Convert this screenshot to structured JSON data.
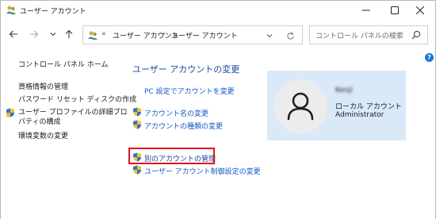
{
  "window": {
    "title": "ユーザー アカウント"
  },
  "address": {
    "separator": "«",
    "crumbs": [
      "ユーザー アカウント",
      "ユーザー アカウント"
    ],
    "crumb_separator": "›"
  },
  "search": {
    "placeholder": "コントロール パネルの検索"
  },
  "help": {
    "label": "?"
  },
  "sidebar": {
    "items": [
      {
        "label": "コントロール パネル ホーム"
      },
      {
        "label": "資格情報の管理"
      },
      {
        "label": "パスワード リセット ディスクの作成"
      },
      {
        "label": "ユーザー プロファイルの詳細プロパティの構成"
      },
      {
        "label": "環境変数の変更"
      }
    ]
  },
  "main": {
    "title": "ユーザー アカウントの変更",
    "links": [
      {
        "label": "PC 設定でアカウントを変更"
      },
      {
        "label": "アカウント名の変更"
      },
      {
        "label": "アカウントの種類の変更"
      },
      {
        "label": "別のアカウントの管理"
      },
      {
        "label": "ユーザー アカウント制御設定の変更"
      }
    ]
  },
  "user": {
    "name": "Kenji",
    "account_type": "ローカル アカウント",
    "role": "Administrator"
  },
  "colors": {
    "link": "#1559c4",
    "title": "#1b4aa0",
    "highlight": "#e1131d",
    "panel": "#d9e9f8"
  },
  "icons": {
    "app": "users-icon",
    "shield": "uac-shield-icon",
    "search": "search-icon",
    "refresh": "refresh-icon"
  }
}
